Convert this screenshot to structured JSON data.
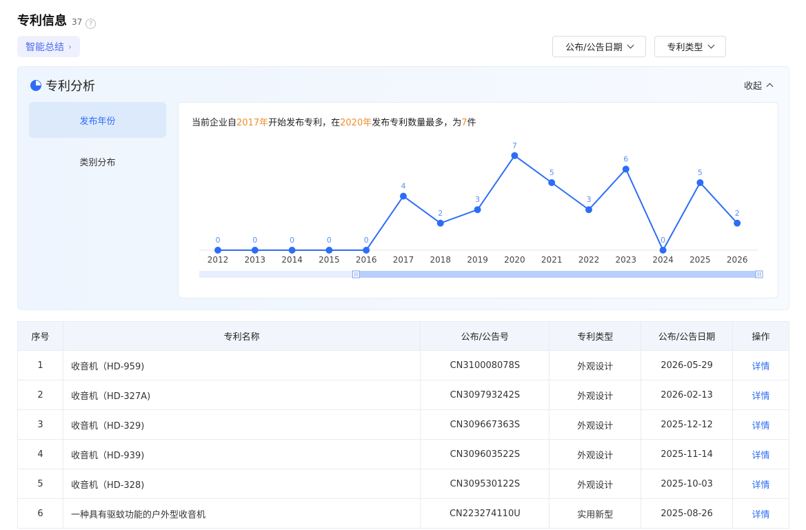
{
  "header": {
    "title": "专利信息",
    "count": "37",
    "help_glyph": "?"
  },
  "ai_summary": {
    "label": "智能总结",
    "chevron": "›"
  },
  "filters": [
    {
      "label": "公布/公告日期"
    },
    {
      "label": "专利类型"
    }
  ],
  "analysis": {
    "title": "专利分析",
    "collapse_label": "收起",
    "tabs": [
      {
        "label": "发布年份",
        "active": true
      },
      {
        "label": "类别分布",
        "active": false
      }
    ],
    "summary": {
      "part1": "当前企业自",
      "start_year": "2017年",
      "part2": "开始发布专利，在",
      "peak_year": "2020年",
      "part3": "发布专利数量最多，为",
      "peak_count": "7",
      "part4": "件"
    }
  },
  "chart_data": {
    "type": "line",
    "x": [
      "2012",
      "2013",
      "2014",
      "2015",
      "2016",
      "2017",
      "2018",
      "2019",
      "2020",
      "2021",
      "2022",
      "2023",
      "2024",
      "2025",
      "2026"
    ],
    "values": [
      0,
      0,
      0,
      0,
      0,
      4,
      2,
      3,
      7,
      5,
      3,
      6,
      0,
      5,
      2
    ],
    "ylim": [
      0,
      7
    ],
    "grid": false,
    "line_color": "#2d6df6",
    "data_label_color": "#5a8ef6",
    "zoom_range_fraction": [
      0.28,
      1.0
    ]
  },
  "table": {
    "headers": [
      "序号",
      "专利名称",
      "公布/公告号",
      "专利类型",
      "公布/公告日期",
      "操作"
    ],
    "rows": [
      {
        "idx": "1",
        "name": "收音机（HD-959)",
        "number": "CN310008078S",
        "type": "外观设计",
        "date": "2026-05-29",
        "op": "详情"
      },
      {
        "idx": "2",
        "name": "收音机（HD-327A)",
        "number": "CN309793242S",
        "type": "外观设计",
        "date": "2026-02-13",
        "op": "详情"
      },
      {
        "idx": "3",
        "name": "收音机（HD-329)",
        "number": "CN309667363S",
        "type": "外观设计",
        "date": "2025-12-12",
        "op": "详情"
      },
      {
        "idx": "4",
        "name": "收音机（HD-939)",
        "number": "CN309603522S",
        "type": "外观设计",
        "date": "2025-11-14",
        "op": "详情"
      },
      {
        "idx": "5",
        "name": "收音机（HD-328)",
        "number": "CN309530122S",
        "type": "外观设计",
        "date": "2025-10-03",
        "op": "详情"
      },
      {
        "idx": "6",
        "name": "一种具有驱蚊功能的户外型收音机",
        "number": "CN223274110U",
        "type": "实用新型",
        "date": "2025-08-26",
        "op": "详情"
      }
    ]
  }
}
